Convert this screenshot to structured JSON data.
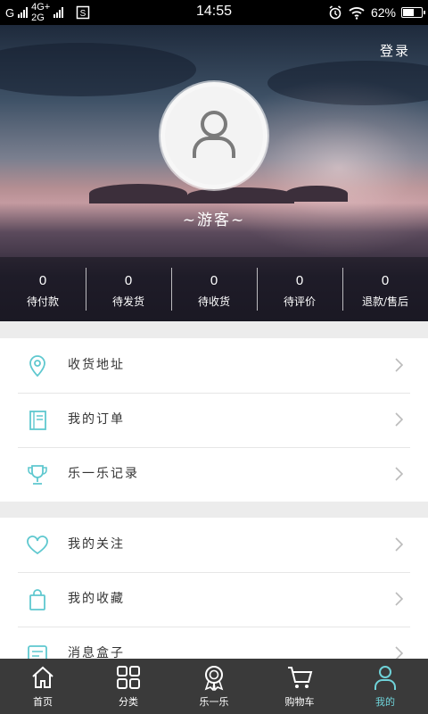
{
  "status_bar": {
    "carrier_left": "G",
    "network_top": "4G+",
    "network_bottom": "2G",
    "time": "14:55",
    "battery": "62%",
    "battery_level": 0.62
  },
  "header": {
    "login_label": "登录",
    "nickname": "~游客~"
  },
  "order_stats": [
    {
      "count": "0",
      "label": "待付款"
    },
    {
      "count": "0",
      "label": "待发货"
    },
    {
      "count": "0",
      "label": "待收货"
    },
    {
      "count": "0",
      "label": "待评价"
    },
    {
      "count": "0",
      "label": "退款/售后"
    }
  ],
  "menu_group_1": [
    {
      "label": "收货地址",
      "icon": "location-pin-icon"
    },
    {
      "label": "我的订单",
      "icon": "order-book-icon"
    },
    {
      "label": "乐一乐记录",
      "icon": "trophy-icon"
    }
  ],
  "menu_group_2": [
    {
      "label": "我的关注",
      "icon": "heart-icon"
    },
    {
      "label": "我的收藏",
      "icon": "shopping-bag-icon"
    },
    {
      "label": "消息盒子",
      "icon": "message-box-icon"
    }
  ],
  "tab_bar": [
    {
      "label": "首页",
      "icon": "home-icon"
    },
    {
      "label": "分类",
      "icon": "category-grid-icon"
    },
    {
      "label": "乐一乐",
      "icon": "medal-icon"
    },
    {
      "label": "购物车",
      "icon": "cart-icon"
    },
    {
      "label": "我的",
      "icon": "user-icon",
      "active": true
    }
  ],
  "colors": {
    "accent": "#5fc8cf",
    "tab_active": "#6fd3d9",
    "tab_bar_bg": "#3a3a3a"
  }
}
